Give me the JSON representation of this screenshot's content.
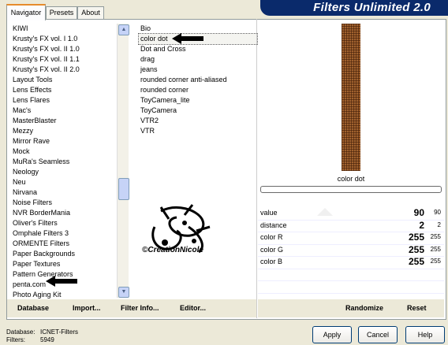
{
  "tabs": [
    "Navigator",
    "Presets",
    "About"
  ],
  "banner_title": "Filters Unlimited 2.0",
  "categories": [
    "KIWI",
    "Krusty's FX vol. I 1.0",
    "Krusty's FX vol. II 1.0",
    "Krusty's FX vol. II 1.1",
    "Krusty's FX vol. II 2.0",
    "Layout Tools",
    "Lens Effects",
    "Lens Flares",
    "Mac's",
    "MasterBlaster",
    "Mezzy",
    "Mirror Rave",
    "Mock",
    "MuRa's Seamless",
    "Neology",
    "Neu",
    "Nirvana",
    "Noise Filters",
    "NVR BorderMania",
    "Oliver's Filters",
    "Omphale Filters 3",
    "ORMENTE Filters",
    "Paper Backgrounds",
    "Paper Textures",
    "Pattern Generators",
    "penta.com",
    "Photo Aging Kit"
  ],
  "filters": [
    "Bio",
    "color dot",
    "Dot and Cross",
    "drag",
    "jeans",
    "rounded corner anti-aliased",
    "rounded corner",
    "ToyCamera_lite",
    "ToyCamera",
    "VTR2",
    "VTR"
  ],
  "selected_category": "penta.com",
  "selected_filter": "color dot",
  "watermark_text": "©CreationNicole",
  "preview_label": "color dot",
  "params": [
    {
      "name": "value",
      "value": "90",
      "raw": "90"
    },
    {
      "name": "distance",
      "value": "2",
      "raw": "2"
    },
    {
      "name": "color R",
      "value": "255",
      "raw": "255"
    },
    {
      "name": "color G",
      "value": "255",
      "raw": "255"
    },
    {
      "name": "color B",
      "value": "255",
      "raw": "255"
    }
  ],
  "bottom_left_buttons": [
    "Database",
    "Import...",
    "Filter Info...",
    "Editor..."
  ],
  "bottom_right_buttons": [
    "Randomize",
    "Reset"
  ],
  "footer": {
    "database_label": "Database:",
    "database_value": "ICNET-Filters",
    "filters_label": "Filters:",
    "filters_value": "5949"
  },
  "dialog_buttons": [
    "Apply",
    "Cancel",
    "Help"
  ],
  "colors": {
    "banner": "#0a2a6b",
    "texture": "#a0612e",
    "tab_accent": "#e68b2c"
  }
}
